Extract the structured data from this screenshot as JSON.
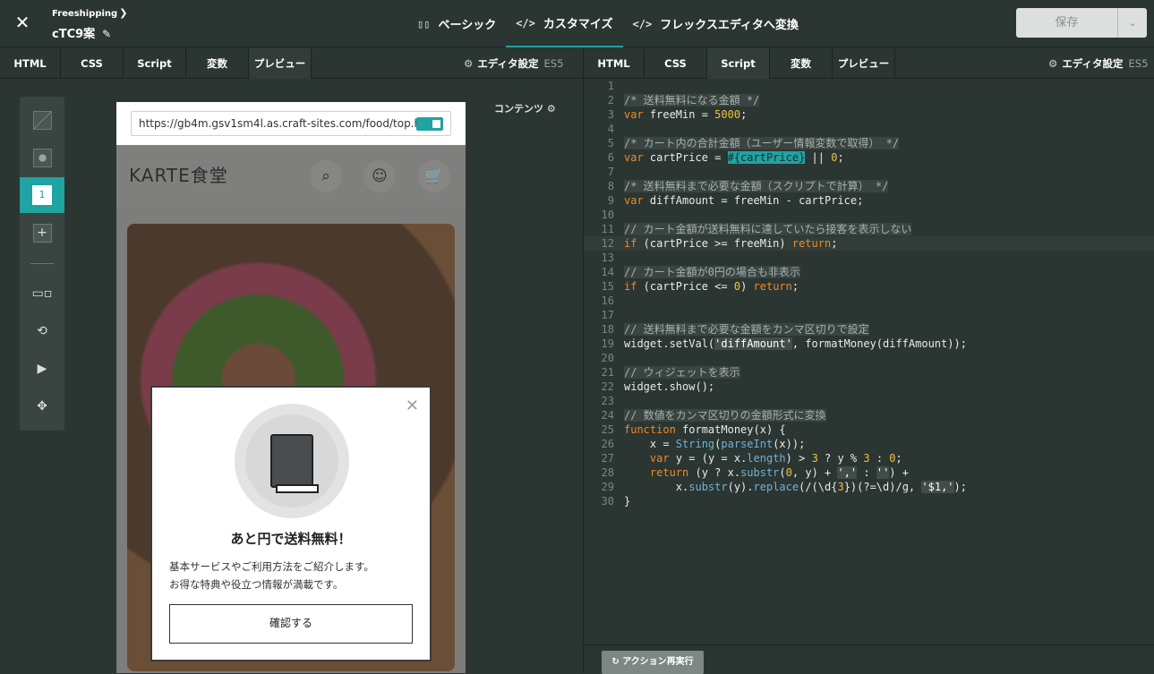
{
  "header": {
    "breadcrumb": "Freeshipping",
    "title": "cTC9案",
    "tabs": [
      {
        "label": "ベーシック",
        "icon": "layout-icon",
        "active": false
      },
      {
        "label": "カスタマイズ",
        "icon": "code-icon",
        "active": true
      },
      {
        "label": "フレックスエディタへ変換",
        "icon": "code-icon",
        "active": false
      }
    ],
    "save_label": "保存"
  },
  "left_tabs": [
    "HTML",
    "CSS",
    "Script",
    "変数",
    "プレビュー"
  ],
  "left_selected": "プレビュー",
  "right_tabs": [
    "HTML",
    "CSS",
    "Script",
    "変数",
    "プレビュー"
  ],
  "right_selected": "Script",
  "editor_settings": {
    "label": "エディタ設定",
    "mode": "ES5"
  },
  "contents_label": "コンテンツ",
  "toolbar": {
    "page_number": "1"
  },
  "preview": {
    "url": "https://gb4m.gsv1sm4l.as.craft-sites.com/food/top.html",
    "site_logo": "KARTE食堂",
    "modal": {
      "title": "あと円で送料無料！",
      "body_line1": "基本サービスやご利用方法をご紹介します。",
      "body_line2": "お得な特典や役立つ情報が満載です。",
      "button": "確認する"
    }
  },
  "code_lines": [
    "",
    "/* 送料無料になる金額 */",
    "var freeMin = 5000;",
    "",
    "/* カート内の合計金額（ユーザー情報変数で取得） */",
    "var cartPrice = #{cartPrice} || 0;",
    "",
    "/* 送料無料まで必要な金額（スクリプトで計算） */",
    "var diffAmount = freeMin - cartPrice;",
    "",
    "// カート金額が送料無料に達していたら接客を表示しない",
    "if (cartPrice >= freeMin) return;",
    "",
    "// カート金額が0円の場合も非表示",
    "if (cartPrice <= 0) return;",
    "",
    "",
    "// 送料無料まで必要な金額をカンマ区切りで設定",
    "widget.setVal('diffAmount', formatMoney(diffAmount));",
    "",
    "// ウィジェットを表示",
    "widget.show();",
    "",
    "// 数値をカンマ区切りの金額形式に変換",
    "function formatMoney(x) {",
    "    x = String(parseInt(x));",
    "    var y = (y = x.length) > 3 ? y % 3 : 0;",
    "    return (y ? x.substr(0, y) + ',' : '') +",
    "        x.substr(y).replace(/(\\d{3})(?=\\d)/g, '$1,');",
    "}"
  ],
  "current_line": 12,
  "rerun_label": "アクション再実行",
  "colors": {
    "accent": "#1fa3a3",
    "keyword": "#f08a24",
    "number": "#f0c23a",
    "function": "#6fb3d9"
  }
}
